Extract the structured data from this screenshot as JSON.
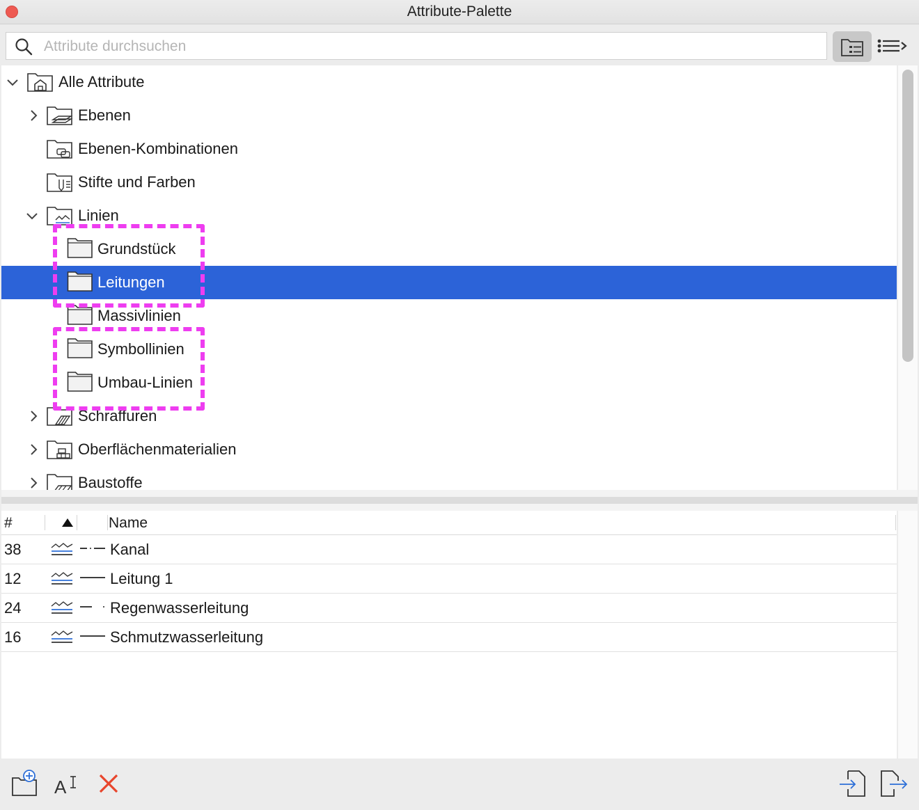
{
  "window": {
    "title": "Attribute-Palette"
  },
  "search": {
    "placeholder": "Attribute durchsuchen",
    "value": ""
  },
  "tree": {
    "root": "Alle Attribute",
    "items": [
      {
        "label": "Ebenen"
      },
      {
        "label": "Ebenen-Kombinationen"
      },
      {
        "label": "Stifte und Farben"
      },
      {
        "label": "Linien"
      },
      {
        "label": "Grundstück"
      },
      {
        "label": "Leitungen"
      },
      {
        "label": "Massivlinien"
      },
      {
        "label": "Symbollinien"
      },
      {
        "label": "Umbau-Linien"
      },
      {
        "label": "Schraffuren"
      },
      {
        "label": "Oberflächenmaterialien"
      },
      {
        "label": "Baustoffe"
      }
    ],
    "selected": "Leitungen"
  },
  "list": {
    "headers": {
      "number": "#",
      "name": "Name"
    },
    "rows": [
      {
        "num": "38",
        "name": "Kanal"
      },
      {
        "num": "12",
        "name": "Leitung 1"
      },
      {
        "num": "24",
        "name": "Regenwasserleitung"
      },
      {
        "num": "16",
        "name": "Schmutzwasserleitung"
      }
    ]
  },
  "colors": {
    "selection": "#2c63d8",
    "highlight": "#ee3df0",
    "delete": "#e8452c",
    "accent": "#2d6fd8"
  }
}
